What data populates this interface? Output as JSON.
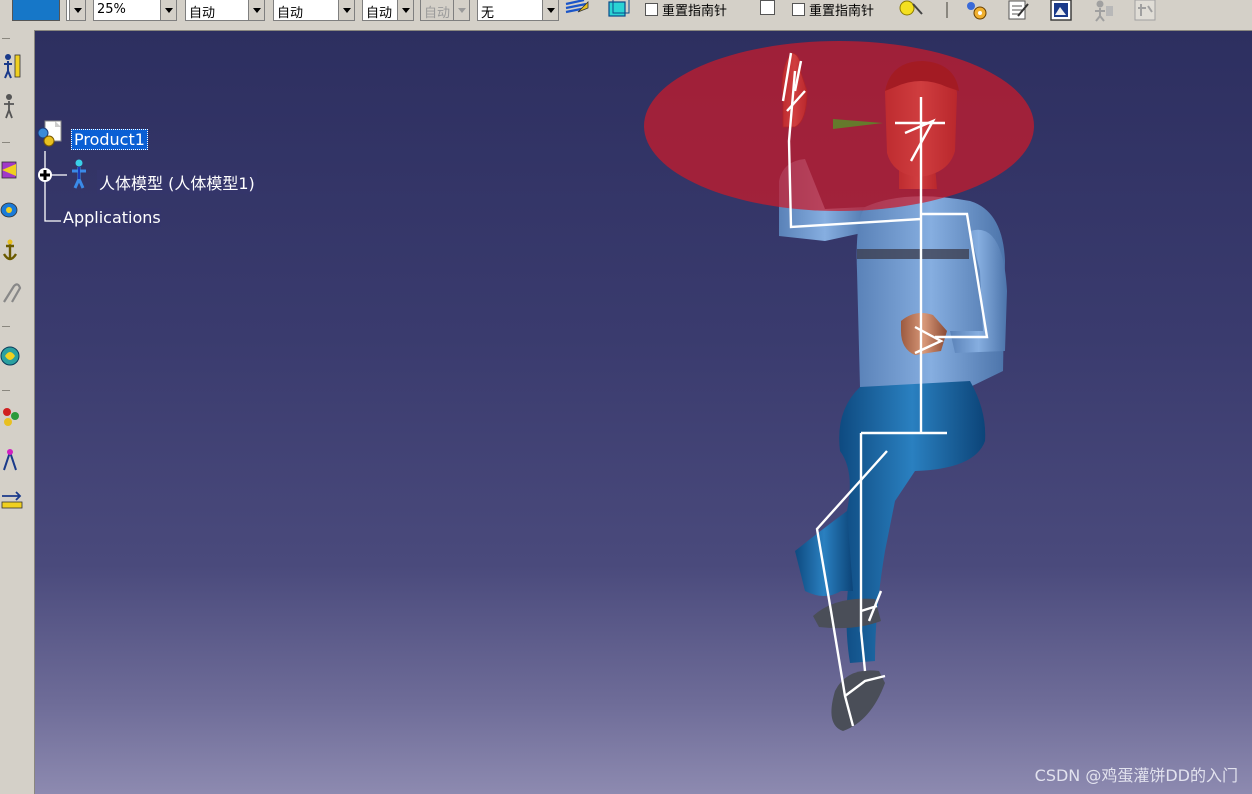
{
  "toolbar": {
    "zoom_value": "25%",
    "combo_auto_1": "自动",
    "combo_auto_2": "自动",
    "combo_auto_3": "自动",
    "combo_auto_4_disabled": "自动",
    "combo_none": "无",
    "reset_compass_1": "重置指南针",
    "reset_compass_2": "重置指南针"
  },
  "tree": {
    "root_label": "Product1",
    "child_label": "人体模型 (人体模型1)",
    "applications_label": "Applications"
  },
  "colors": {
    "viewport_top": "#2d2f60",
    "viewport_bottom": "#8d8ab0",
    "selection": "#0a5fd4",
    "vision_cone": "#cc1a2a",
    "shirt": "#6e96c8",
    "pants": "#1a64a0",
    "skin": "#c88a6a",
    "skeleton": "#ffffff"
  },
  "watermark": "CSDN @鸡蛋灌饼DD的入门"
}
